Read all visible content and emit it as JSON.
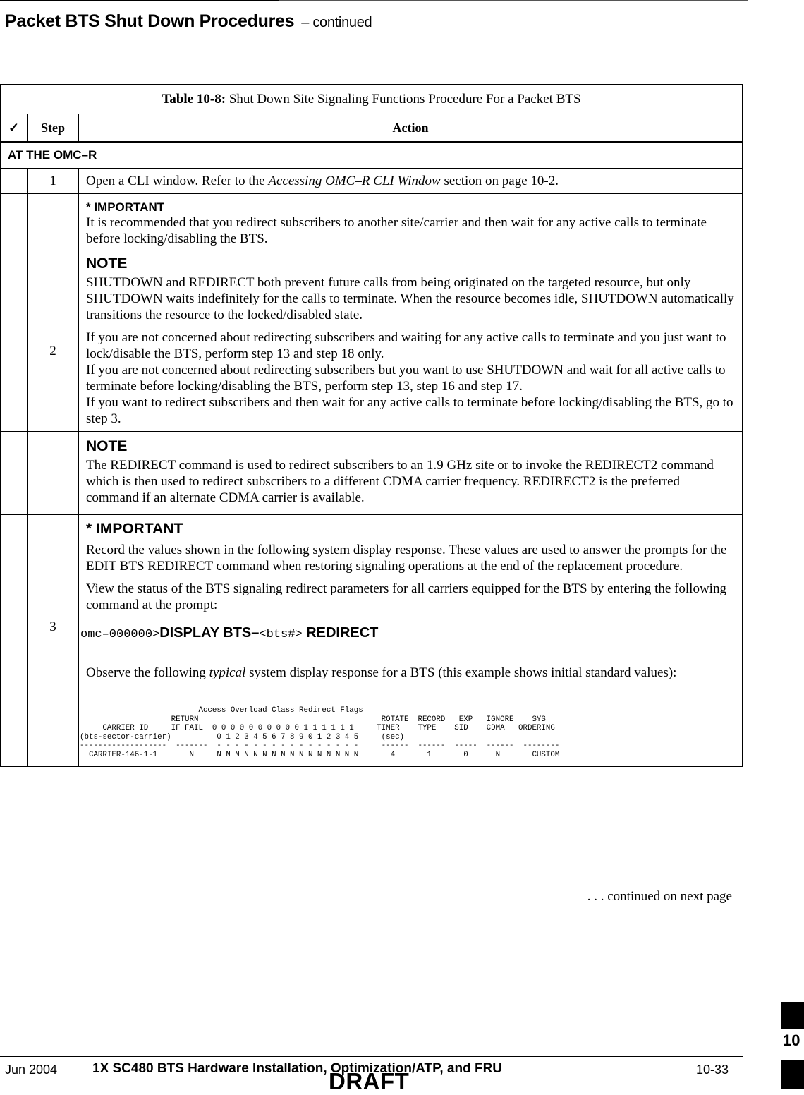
{
  "page_header": {
    "title": "Packet BTS Shut Down Procedures",
    "continued": "– continued"
  },
  "table": {
    "caption_label": "Table 10-8:",
    "caption_text": " Shut Down Site Signaling Functions Procedure For a Packet BTS",
    "columns": {
      "check_icon": "check-mark-icon",
      "check_glyph": "✓",
      "step": "Step",
      "action": "Action"
    },
    "section": "AT THE OMC–R",
    "rows": [
      {
        "step": "1",
        "text_before": "Open a CLI window. Refer to the ",
        "text_italic": "Accessing OMC–R CLI Window",
        "text_after": " section on page 10-2."
      },
      {
        "step": "2",
        "important_label": "* IMPORTANT",
        "important_text": "It is recommended that you redirect subscribers to another site/carrier and then wait for any active calls to terminate before locking/disabling the BTS.",
        "note_label": "NOTE",
        "note_text": "SHUTDOWN and REDIRECT both prevent future calls from being originated on the targeted resource, but only SHUTDOWN waits indefinitely for the calls to terminate. When the resource becomes idle, SHUTDOWN automatically transitions the resource to the locked/disabled state.",
        "paragraphs": [
          "If you are not concerned about redirecting subscribers and waiting for any active calls to terminate and you just want to lock/disable the BTS, perform step 13 and step 18 only.",
          "If you are not concerned about redirecting subscribers but you want to use SHUTDOWN and wait for all active calls to terminate before locking/disabling the BTS, perform step 13, step 16 and step 17.",
          "If you want to redirect subscribers and then wait for any active calls to terminate before locking/disabling the BTS, go to step 3."
        ]
      },
      {
        "step": "",
        "note_label": "NOTE",
        "note_text": "The REDIRECT command is used to redirect subscribers to an 1.9 GHz site or to invoke the REDIRECT2 command which is then used to redirect subscribers to a different CDMA carrier frequency. REDIRECT2 is the preferred command if an alternate CDMA carrier is available."
      },
      {
        "step": "3",
        "important_label": "* IMPORTANT",
        "important_text": "Record the values shown in the following system display response. These values are used to answer the prompts for the EDIT BTS REDIRECT command when restoring signaling operations at the end of the replacement procedure.",
        "instruction": "View the status of the BTS signaling redirect parameters for all carriers equipped for the BTS by entering the following command at the prompt:",
        "command": {
          "prompt": "omc–000000>",
          "cmd1": "DISPLAY BTS–",
          "param": "<bts#>",
          "cmd2": " REDIRECT"
        },
        "observe_before": "Observe the following ",
        "observe_italic": "typical",
        "observe_after": " system display response for a BTS (this example shows initial standard values):",
        "response": {
          "lines": [
            "                          Access Overload Class Redirect Flags",
            "                    RETURN                                        ROTATE  RECORD   EXP   IGNORE    SYS",
            "     CARRIER ID     IF FAIL  0 0 0 0 0 0 0 0 0 0 1 1 1 1 1 1     TIMER    TYPE    SID    CDMA   ORDERING",
            "(bts-sector-carrier)          0 1 2 3 4 5 6 7 8 9 0 1 2 3 4 5     (sec)",
            "-------------------  -------  - - - - - - - - - - - - - - - -     ------  ------  -----  ------  --------",
            "  CARRIER-146-1-1       N     N N N N N N N N N N N N N N N N       4       1       0      N       CUSTOM"
          ],
          "columns": [
            "CARRIER ID (bts-sector-carrier)",
            "RETURN IF FAIL",
            "Access Overload Class Redirect Flags 00-15",
            "ROTATE TIMER (sec)",
            "RECORD TYPE",
            "EXP SID",
            "IGNORE CDMA",
            "SYS ORDERING"
          ],
          "row": {
            "carrier_id": "CARRIER-146-1-1",
            "return_if_fail": "N",
            "flags": [
              "N",
              "N",
              "N",
              "N",
              "N",
              "N",
              "N",
              "N",
              "N",
              "N",
              "N",
              "N",
              "N",
              "N",
              "N",
              "N"
            ],
            "rotate_timer": "4",
            "record_type": "1",
            "exp_sid": "0",
            "ignore_cdma": "N",
            "sys_ordering": "CUSTOM"
          }
        }
      }
    ],
    "continued_note": ". . . continued on next page"
  },
  "footer": {
    "date": "Jun 2004",
    "title": "1X SC480 BTS Hardware Installation, Optimization/ATP, and FRU",
    "page": "10-33",
    "draft": "DRAFT",
    "chapter_tab": "10"
  }
}
